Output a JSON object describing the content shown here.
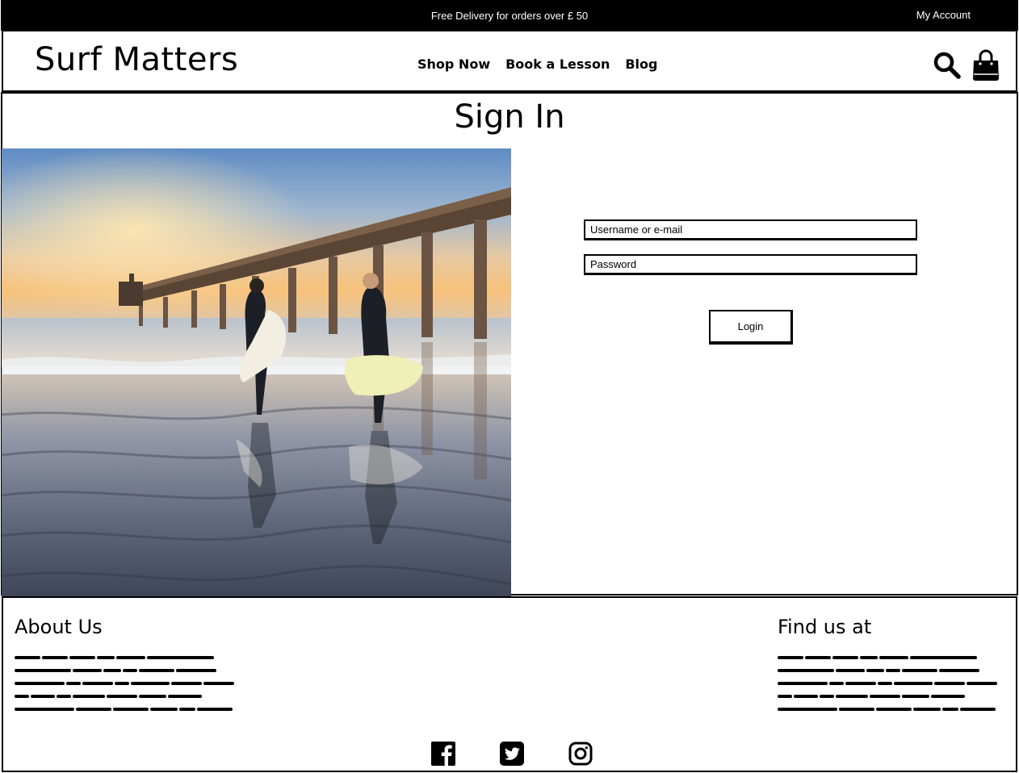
{
  "topbar": {
    "promo": "Free Delivery for orders over £ 50",
    "account_link": "My Account"
  },
  "header": {
    "logo": "Surf Matters",
    "nav": [
      "Shop Now",
      "Book a Lesson",
      "Blog"
    ],
    "icons": [
      "search-icon",
      "shopping-bag-icon"
    ]
  },
  "main": {
    "title": "Sign In",
    "image": "two surfers walking on beach beside pier at sunset",
    "username_placeholder": "Username or e-mail",
    "password_placeholder": "Password",
    "login_label": "Login"
  },
  "footer": {
    "about_title": "About Us",
    "find_title": "Find us at",
    "social_icons": [
      "facebook-icon",
      "twitter-icon",
      "instagram-icon"
    ]
  },
  "colors": {
    "topbar_bg": "#000000",
    "text": "#000000",
    "background": "#ffffff"
  }
}
